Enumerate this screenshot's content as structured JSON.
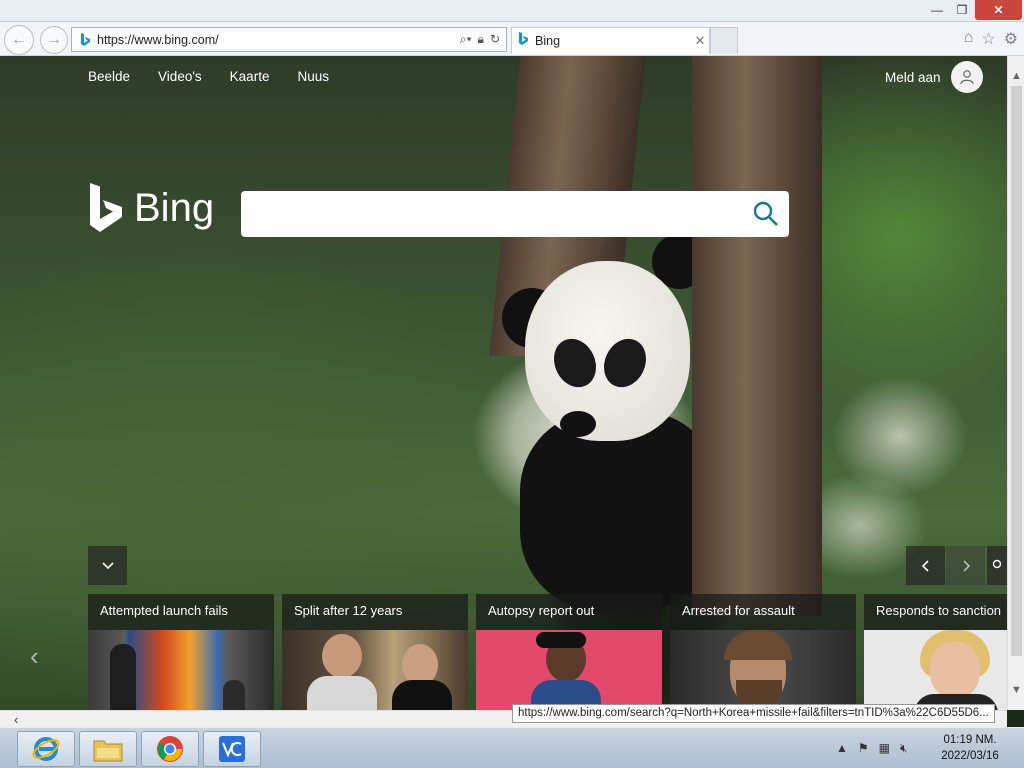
{
  "window": {
    "title": "",
    "min_glyph": "—",
    "max_glyph": "❐",
    "close_glyph": "✕"
  },
  "nav": {
    "back_glyph": "←",
    "forward_glyph": "→",
    "url": "https://www.bing.com/",
    "tab_label": "Bing",
    "tab_close": "✕"
  },
  "bing": {
    "nav_items": [
      "Beelde",
      "Video's",
      "Kaarte",
      "Nuus"
    ],
    "sign_in": "Meld aan",
    "logo_text": "Bing",
    "search_placeholder": ""
  },
  "news": [
    {
      "headline": "Attempted launch fails"
    },
    {
      "headline": "Split after 12 years"
    },
    {
      "headline": "Autopsy report out"
    },
    {
      "headline": "Arrested for assault"
    },
    {
      "headline": "Responds to sanction"
    }
  ],
  "status_url": "https://www.bing.com/search?q=North+Korea+missile+fail&filters=tnTID%3a%22C6D55D6...",
  "taskbar": {
    "apps": [
      "internet-explorer",
      "file-explorer",
      "chrome",
      "app"
    ],
    "clock_time": "01:19 NM.",
    "clock_date": "2022/03/16"
  },
  "colors": {
    "bing_accent": "#0f7c8a",
    "close_button": "#c9463d"
  }
}
